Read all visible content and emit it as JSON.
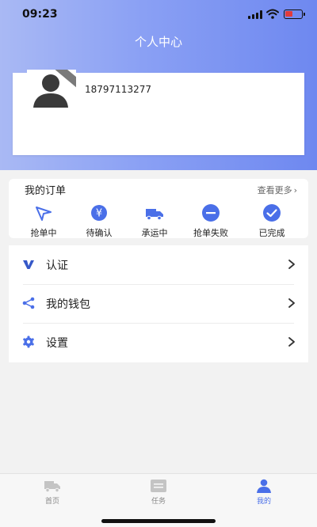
{
  "status_bar": {
    "time": "09:23"
  },
  "header": {
    "title": "个人中心"
  },
  "profile": {
    "phone": "18797113277"
  },
  "orders": {
    "title": "我的订单",
    "more_label": "查看更多",
    "items": [
      {
        "label": "抢单中",
        "icon": "paper-plane-icon"
      },
      {
        "label": "待确认",
        "icon": "yen-icon"
      },
      {
        "label": "承运中",
        "icon": "truck-icon"
      },
      {
        "label": "抢单失败",
        "icon": "minus-circle-icon"
      },
      {
        "label": "已完成",
        "icon": "check-circle-icon"
      }
    ]
  },
  "menu": {
    "items": [
      {
        "label": "认证",
        "icon": "verify-v-icon"
      },
      {
        "label": "我的钱包",
        "icon": "share-icon"
      },
      {
        "label": "设置",
        "icon": "gear-icon"
      }
    ]
  },
  "tabbar": {
    "items": [
      {
        "label": "首页",
        "icon": "truck-icon",
        "active": false
      },
      {
        "label": "任务",
        "icon": "list-icon",
        "active": false
      },
      {
        "label": "我的",
        "icon": "user-icon",
        "active": true
      }
    ]
  },
  "colors": {
    "accent": "#4a6fe8",
    "header_start": "#a9b9f4",
    "header_end": "#6e88f0"
  }
}
